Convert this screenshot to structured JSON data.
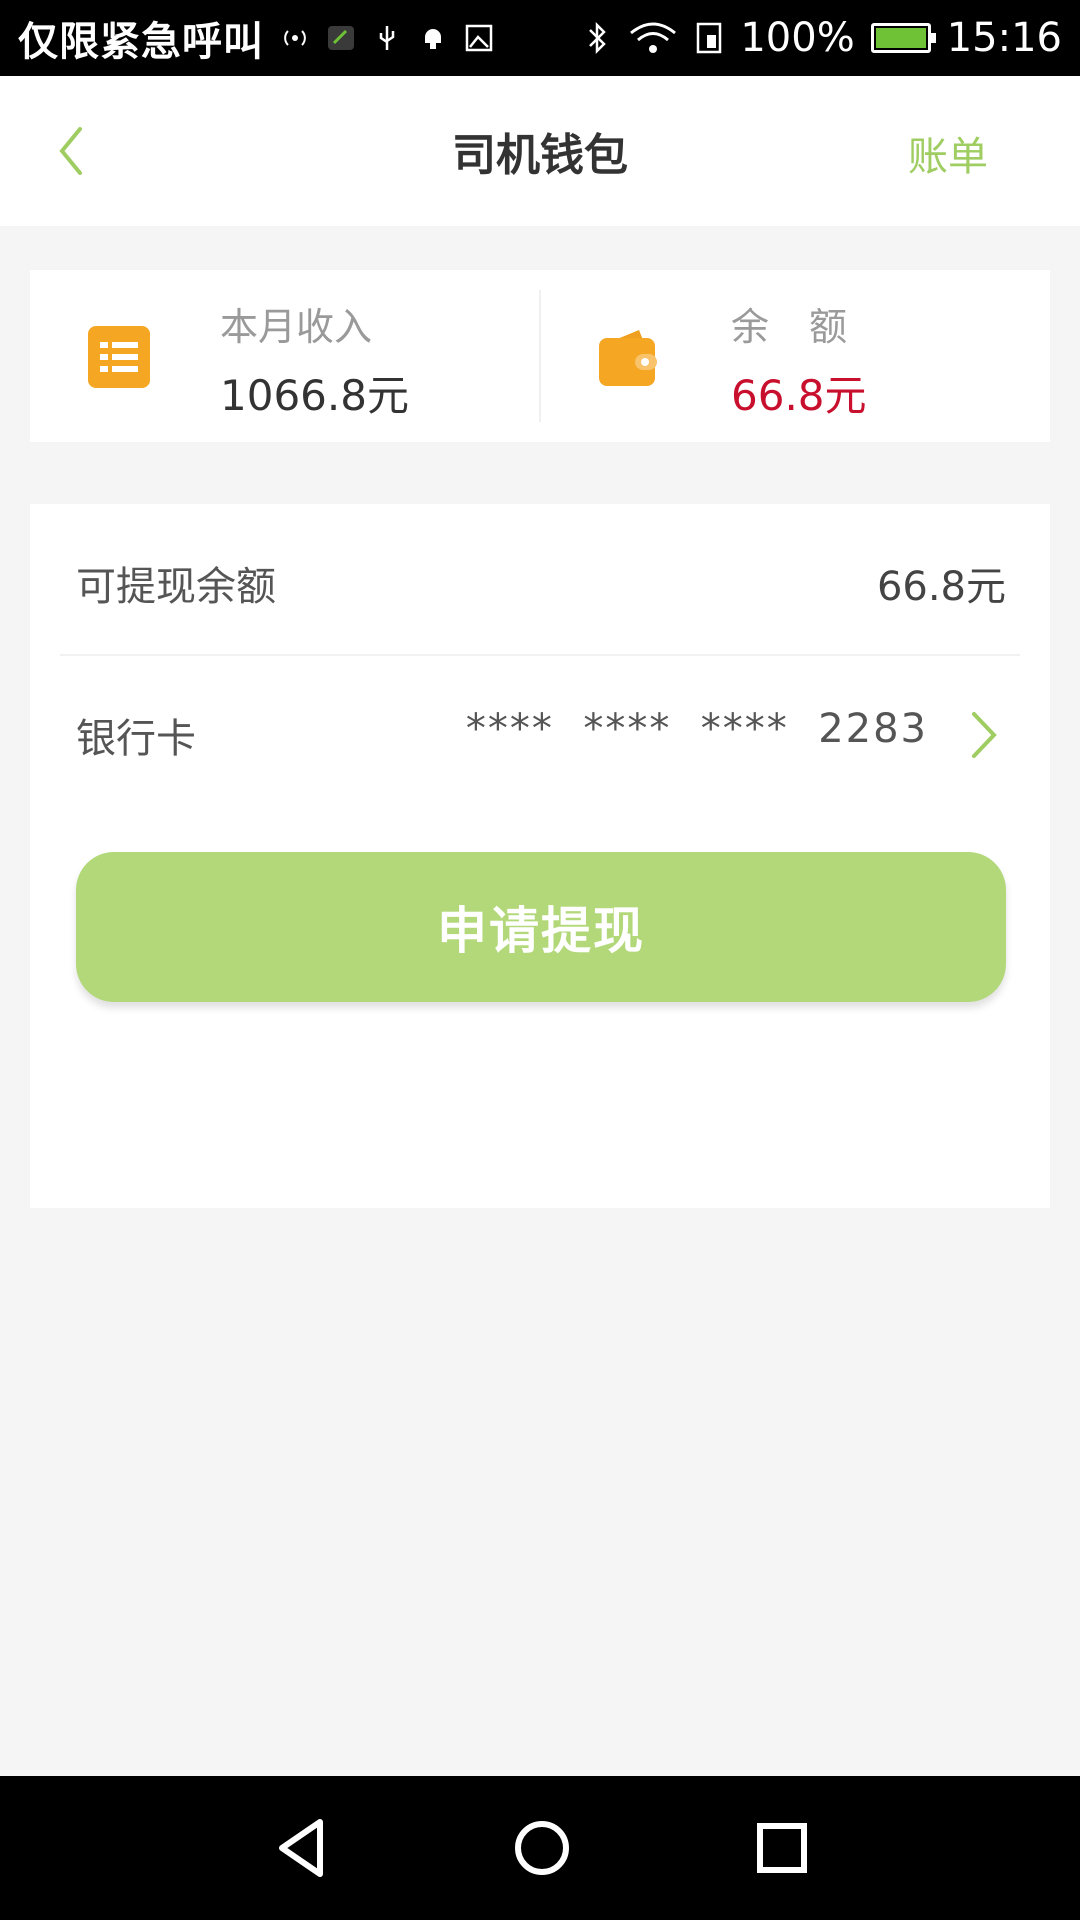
{
  "status_bar": {
    "carrier": "仅限紧急呼叫",
    "battery": "100%",
    "time": "15:16"
  },
  "header": {
    "title": "司机钱包",
    "bill_link": "账单"
  },
  "summary": {
    "monthly_income": {
      "label": "本月收入",
      "value": "1066.8元"
    },
    "balance": {
      "label": "余额",
      "value": "66.8元"
    }
  },
  "withdraw": {
    "available": {
      "label": "可提现余额",
      "value": "66.8元"
    },
    "bank_card": {
      "label": "银行卡",
      "masked_number": "****  ****  ****  2283"
    },
    "apply_button": "申请提现"
  },
  "colors": {
    "accent": "#9fcd62",
    "button": "#b2d879",
    "balance_red": "#c8102e",
    "icon_orange": "#f5a623"
  }
}
